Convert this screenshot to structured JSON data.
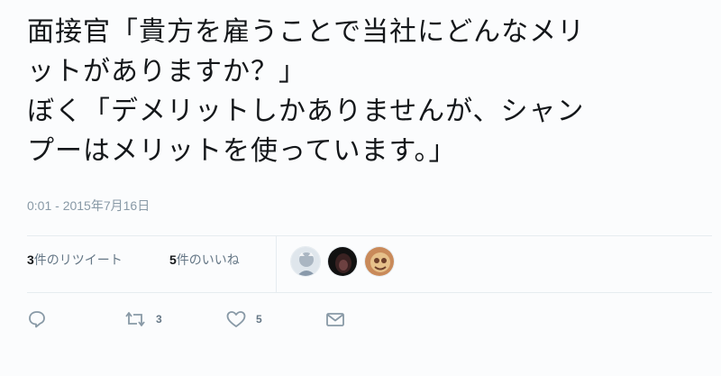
{
  "tweet": {
    "text_lines": [
      "面接官「貴方を雇うことで当社にどんなメリ",
      "ットがありますか？」",
      "ぼく「デメリットしかありませんが、シャン",
      "プーはメリットを使っています。」"
    ],
    "timestamp": "0:01 - 2015年7月16日"
  },
  "stats": {
    "retweets_count": "3",
    "retweets_label": "件のリツイート",
    "likes_count": "5",
    "likes_label": "件のいいね"
  },
  "avatars": [
    {
      "name": "avatar-1",
      "colors": {
        "bg": "#c9d3dc",
        "fg": "#7d8ea0"
      }
    },
    {
      "name": "avatar-2",
      "colors": {
        "bg": "#1a1a1a",
        "fg": "#6b3a3a"
      }
    },
    {
      "name": "avatar-3",
      "colors": {
        "bg": "#c98a5a",
        "fg": "#6e3f2a"
      }
    }
  ],
  "actions": {
    "reply_icon": "reply-icon",
    "retweet_icon": "retweet-icon",
    "retweet_count": "3",
    "like_icon": "heart-icon",
    "like_count": "5",
    "dm_icon": "envelope-icon"
  },
  "colors": {
    "text": "#14171a",
    "muted": "#8899a6",
    "divider": "#e6ecf0"
  }
}
